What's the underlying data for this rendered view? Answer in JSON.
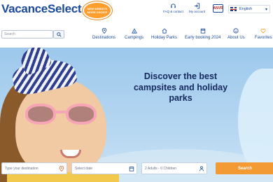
{
  "header": {
    "logo_text": "VacanceSelect",
    "badge_text": "NEW WEBSITE MORE CHOICE",
    "faq_label": "FAQ & contact",
    "account_label": "My account",
    "ana_logo_text": "ANVR",
    "language": "English"
  },
  "nav": {
    "search_placeholder": "Search",
    "items": [
      {
        "label": "Destinations",
        "icon": "map-pin-icon"
      },
      {
        "label": "Campings",
        "icon": "tent-icon"
      },
      {
        "label": "Holiday Parks",
        "icon": "house-icon"
      },
      {
        "label": "Early booking 2024",
        "icon": "calendar-icon"
      },
      {
        "label": "About Us",
        "icon": "smile-icon"
      },
      {
        "label": "Favorites",
        "icon": "heart-icon"
      }
    ]
  },
  "hero": {
    "title": "Discover the best campsites and holiday parks"
  },
  "booking": {
    "destination_placeholder": "Type your destination",
    "date_placeholder": "Select date",
    "guests_value": "2 Adults - 0 Children",
    "search_label": "Search"
  },
  "colors": {
    "brand_blue": "#1a4a9c",
    "accent_orange": "#f39a35"
  }
}
